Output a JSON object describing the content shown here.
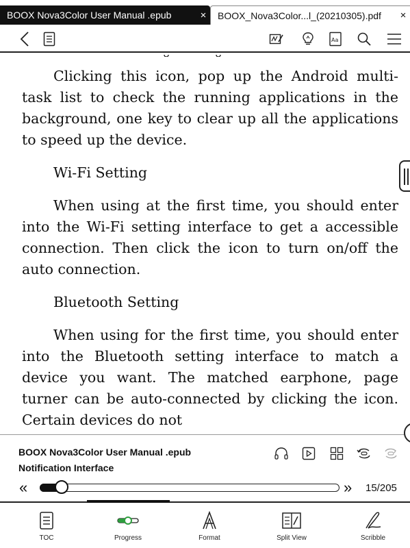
{
  "tabs": [
    {
      "title": "BOOX Nova3Color User Manual .epub",
      "active": true,
      "close": "×"
    },
    {
      "title": "BOOX_Nova3Color...l_(20210305).pdf",
      "active": false,
      "close": "×"
    }
  ],
  "toolbar": {
    "back_icon": "chevron-left-icon",
    "toc_icon": "document-list-icon",
    "tools": [
      "handwriting-icon",
      "lightbulb-icon",
      "font-settings-icon",
      "search-icon",
      "menu-icon"
    ]
  },
  "content": {
    "paragraphs": [
      {
        "type": "indent",
        "text": "Clicking this icon, pop up the Android multi-task list to check the running applications in the background, one key to clear up all the applications to speed up the device."
      },
      {
        "type": "heading",
        "text": "Wi-Fi Setting"
      },
      {
        "type": "indent",
        "text": "When using at the first time, you should enter into the Wi-Fi setting interface to get a accessible connection. Then click the icon to turn on/off the auto connection."
      },
      {
        "type": "heading",
        "text": "Bluetooth Setting"
      },
      {
        "type": "indent",
        "text": "When using for the first time, you should enter into the Bluetooth setting interface to match a device you want. The matched earphone, page turner can be auto-connected by clicking the icon. Certain devices do not"
      }
    ]
  },
  "info_panel": {
    "book_title": "BOOX Nova3Color User Manual .epub",
    "chapter_title": "Notification Interface",
    "icons": [
      "headphones-icon",
      "play-icon",
      "grid-icon",
      "refresh-icon",
      "sync-icon"
    ],
    "progress_fraction": 0.073,
    "prev_glyph": "«",
    "next_glyph": "»",
    "page_label": "15/205"
  },
  "bottom_nav": [
    {
      "label": "TOC",
      "icon": "toc-icon",
      "active": false
    },
    {
      "label": "Progress",
      "icon": "progress-icon",
      "active": true
    },
    {
      "label": "Format",
      "icon": "format-icon",
      "active": false
    },
    {
      "label": "Split View",
      "icon": "split-view-icon",
      "active": false
    },
    {
      "label": "Scribble",
      "icon": "scribble-icon",
      "active": false
    }
  ]
}
